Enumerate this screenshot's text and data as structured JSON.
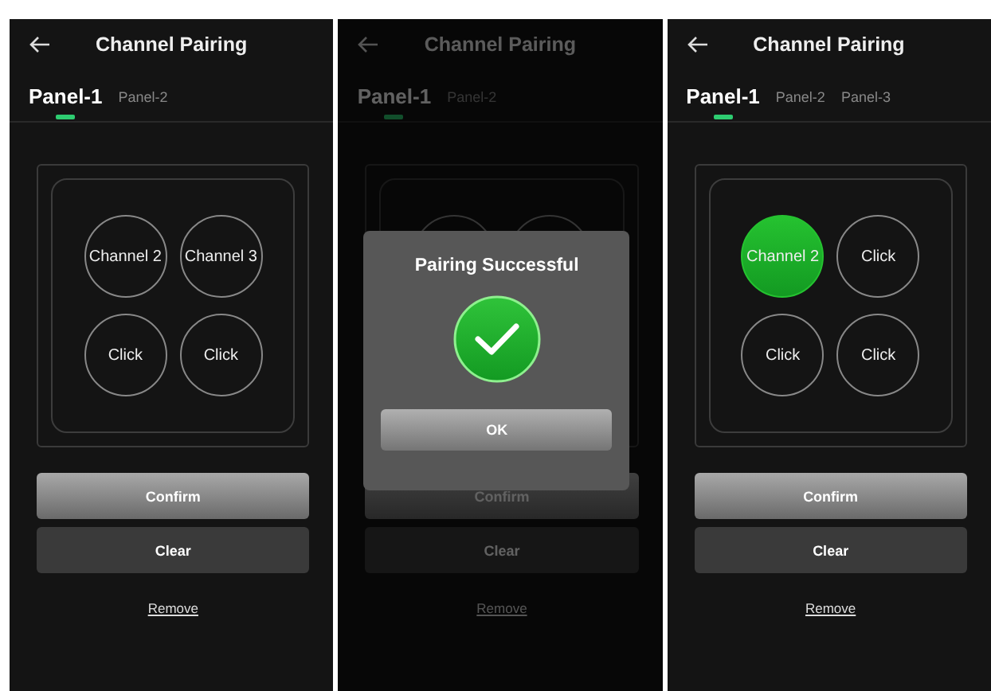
{
  "screens": [
    {
      "title": "Channel Pairing",
      "dimmed": false,
      "tabs": [
        {
          "label": "Panel-1",
          "selected": true
        },
        {
          "label": "Panel-2",
          "selected": false
        }
      ],
      "channels": [
        {
          "label": "Channel 2",
          "paired": false
        },
        {
          "label": "Channel 3",
          "paired": false
        },
        {
          "label": "Click",
          "paired": false
        },
        {
          "label": "Click",
          "paired": false
        }
      ],
      "buttons": [
        {
          "label": "Confirm",
          "kind": "primary"
        },
        {
          "label": "Clear",
          "kind": "secondary"
        }
      ],
      "link": "Remove"
    },
    {
      "title": "Channel Pairing",
      "dimmed": true,
      "tabs": [
        {
          "label": "Panel-1",
          "selected": true
        },
        {
          "label": "Panel-2",
          "selected": false
        }
      ],
      "channels": [
        {
          "paired": false
        },
        {
          "paired": false
        }
      ],
      "buttons": [
        {
          "label": "Confirm",
          "kind": "primary"
        },
        {
          "label": "Clear",
          "kind": "secondary"
        }
      ],
      "link": "Remove",
      "dialog": {
        "title": "Pairing Successful",
        "button": "OK"
      }
    },
    {
      "title": "Channel Pairing",
      "dimmed": false,
      "tabs": [
        {
          "label": "Panel-1",
          "selected": true
        },
        {
          "label": "Panel-2",
          "selected": false
        },
        {
          "label": "Panel-3",
          "selected": false
        }
      ],
      "channels": [
        {
          "label": "Channel 2",
          "paired": true
        },
        {
          "label": "Click",
          "paired": false
        },
        {
          "label": "Click",
          "paired": false
        },
        {
          "label": "Click",
          "paired": false
        }
      ],
      "buttons": [
        {
          "label": "Confirm",
          "kind": "primary"
        },
        {
          "label": "Clear",
          "kind": "secondary"
        }
      ],
      "link": "Remove"
    }
  ]
}
